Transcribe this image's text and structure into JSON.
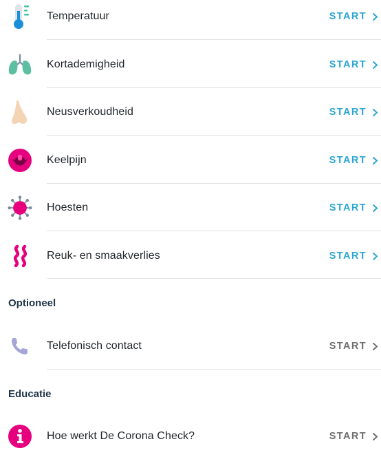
{
  "symptoms": {
    "items": [
      {
        "label": "Temperatuur",
        "action": "START",
        "icon": "thermometer-icon"
      },
      {
        "label": "Kortademigheid",
        "action": "START",
        "icon": "lungs-icon"
      },
      {
        "label": "Neusverkoudheid",
        "action": "START",
        "icon": "nose-icon"
      },
      {
        "label": "Keelpijn",
        "action": "START",
        "icon": "throat-icon"
      },
      {
        "label": "Hoesten",
        "action": "START",
        "icon": "virus-icon"
      },
      {
        "label": "Reuk- en smaakverlies",
        "action": "START",
        "icon": "smell-waves-icon"
      }
    ]
  },
  "optional": {
    "title": "Optioneel",
    "items": [
      {
        "label": "Telefonisch contact",
        "action": "START",
        "icon": "phone-icon"
      }
    ]
  },
  "education": {
    "title": "Educatie",
    "items": [
      {
        "label": "Hoe werkt De Corona Check?",
        "action": "START",
        "icon": "info-icon"
      }
    ]
  },
  "colors": {
    "accent": "#2aa6d1",
    "muted": "#6e6e6e",
    "magenta": "#e6007e",
    "section_title": "#1d3347"
  }
}
